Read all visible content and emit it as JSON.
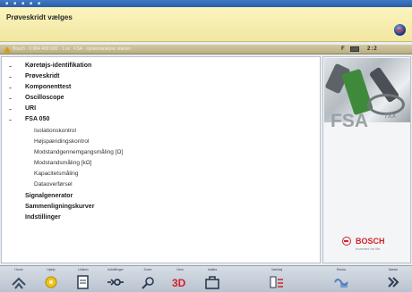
{
  "window": {
    "title_dots": "▪ ▪ ▪ ▪ ▪"
  },
  "header": {
    "title": "Prøveskridt vælges"
  },
  "status": {
    "text": "Bosch · 0 684 400 630 · 1.xx · FSA · systemanalyse starten",
    "right_1": "F",
    "right_3": "2:2"
  },
  "tree": {
    "items": [
      {
        "label": "Køretøjs-identifikation",
        "level": 0
      },
      {
        "label": "Prøveskridt",
        "level": 0
      },
      {
        "label": "Komponenttest",
        "level": 0
      },
      {
        "label": "Oscilloscope",
        "level": 0
      },
      {
        "label": "URI",
        "level": 0
      },
      {
        "label": "FSA 050",
        "level": 0
      },
      {
        "label": "Isolationskontrol",
        "level": 1
      },
      {
        "label": "Højspændingskontrol",
        "level": 1
      },
      {
        "label": "Modstandgennemgangsmåling [Ω]",
        "level": 1
      },
      {
        "label": "Modstandsmåling [kΩ]",
        "level": 1
      },
      {
        "label": "Kapacitetsmåling",
        "level": 1
      },
      {
        "label": "Dataoverførsel",
        "level": 1
      },
      {
        "label": "Signalgenerator",
        "level": 0
      },
      {
        "label": "Sammenligningskurver",
        "level": 0
      },
      {
        "label": "Indstillinger",
        "level": 0
      }
    ]
  },
  "side": {
    "product": "FSA",
    "product_sub": "7XX",
    "brand": "BOSCH",
    "brand_tag": "Invented for life"
  },
  "toolbar": {
    "buttons": [
      {
        "label": "Home",
        "icon": "home-icon"
      },
      {
        "label": "Hjælp",
        "icon": "help-icon"
      },
      {
        "label": "Udskriv",
        "icon": "print-icon"
      },
      {
        "label": "Indstillinger",
        "icon": "settings-icon"
      },
      {
        "label": "Zoom",
        "icon": "zoom-icon"
      },
      {
        "label": "Gem",
        "icon": "save-icon"
      },
      {
        "label": "Indlæs",
        "icon": "load-icon"
      },
      {
        "label": "Værktøj",
        "icon": "tools-icon"
      },
      {
        "label": "Ekstra",
        "icon": "extra-icon"
      },
      {
        "label": "Næste",
        "icon": "next-icon"
      }
    ]
  },
  "colors": {
    "header_bg": "#f1e7a2",
    "titlebar": "#2a5ea8",
    "bosch_red": "#d3222a"
  }
}
